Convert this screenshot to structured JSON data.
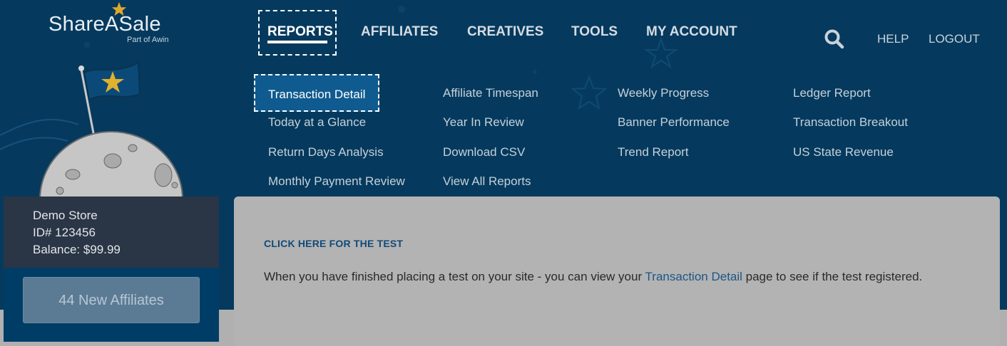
{
  "brand": {
    "name": "ShareASale",
    "sub": "Part of Awin",
    "star_color": "#e0a82e"
  },
  "nav": {
    "items": [
      {
        "label": "REPORTS",
        "active": true
      },
      {
        "label": "AFFILIATES"
      },
      {
        "label": "CREATIVES"
      },
      {
        "label": "TOOLS"
      },
      {
        "label": "MY ACCOUNT"
      }
    ],
    "search_icon": "search-icon",
    "help": "HELP",
    "logout": "LOGOUT"
  },
  "reports_menu": {
    "columns": [
      [
        "Transaction Detail",
        "Today at a Glance",
        "Return Days Analysis",
        "Monthly Payment Review"
      ],
      [
        "Affiliate Timespan",
        "Year In Review",
        "Download CSV",
        "View All Reports"
      ],
      [
        "Weekly Progress",
        "Banner Performance",
        "Trend Report"
      ],
      [
        "Ledger Report",
        "Transaction Breakout",
        "US State Revenue"
      ]
    ]
  },
  "account": {
    "store": "Demo Store",
    "id": "ID# 123456",
    "balance": "Balance: $99.99",
    "new_affiliates_button": "44 New Affiliates"
  },
  "main": {
    "test_link": "CLICK HERE FOR THE TEST",
    "text_before": "When you have finished placing a test on your site - you can view your ",
    "text_link": "Transaction Detail",
    "text_after": " page to see if the test registered."
  },
  "colors": {
    "header_bg": "#053a5e",
    "sidebar_dark": "#2a3545",
    "sidebar_blue": "#003d66",
    "panel_bg": "#b3b3b3",
    "active_menu": "#0f5b8f"
  }
}
